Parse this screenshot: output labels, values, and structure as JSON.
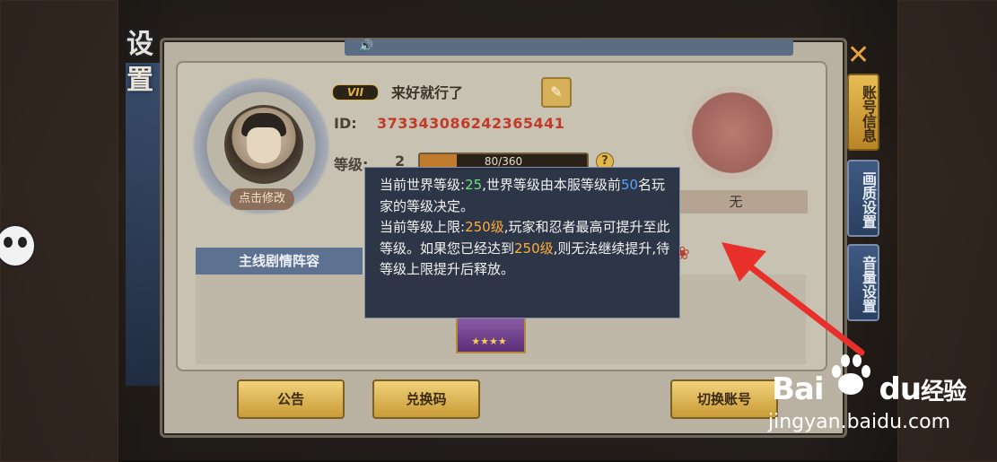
{
  "panel": {
    "title": "设置",
    "sound_icon": "speaker-icon"
  },
  "profile": {
    "vip_badge": "VII",
    "nickname": "来好就行了",
    "edit_avatar_label": "点击修改",
    "id_label": "ID:",
    "id_value": "373343086242365441",
    "level_label": "等级:",
    "level_value": "2",
    "exp_text": "80/360",
    "exp_progress": 0.222,
    "help_label": "?",
    "right_name": "无"
  },
  "lineup": {
    "title": "主线剧情阵容",
    "card_stars": "★★★★"
  },
  "tooltip": {
    "line1_prefix": "当前世界等级:",
    "line1_value": "25",
    "line1_suffix": ",世界等级由本服等级前",
    "line1_rank": "50",
    "line1_end": "名玩家的等级决定。",
    "line2_prefix": "当前等级上限:",
    "line2_value": "250级",
    "line2_mid": ",玩家和忍者最高可提升至此等级。如果您已经达到",
    "line2_value2": "250级",
    "line2_end": ",则无法继续提升,待等级上限提升后释放。"
  },
  "buttons": {
    "announcement": "公告",
    "redeem_code": "兑换码",
    "switch_account": "切换账号"
  },
  "side_tabs": [
    {
      "label": "账号信息",
      "active": true
    },
    {
      "label": "画质设置",
      "active": false
    },
    {
      "label": "音量设置",
      "active": false
    }
  ],
  "watermark": {
    "brand": "Bai",
    "brand2": "du",
    "brand3": "经验",
    "url": "jingyan.baidu.com"
  },
  "colors": {
    "accent_gold": "#e0b84c",
    "id_red": "#c43a2a",
    "tooltip_green": "#6ee37a",
    "tooltip_blue": "#5aa0ff",
    "tooltip_orange": "#ffad3c",
    "arrow_red": "#e8302a"
  }
}
